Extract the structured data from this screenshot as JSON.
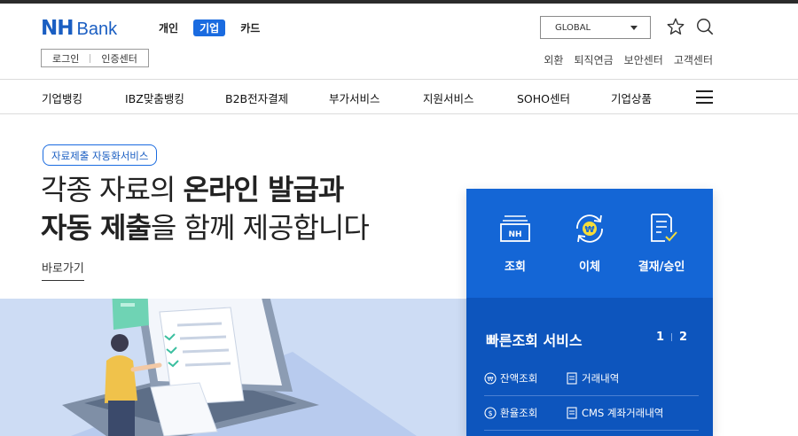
{
  "header": {
    "logo_nh": "NH",
    "logo_bank": "Bank",
    "segments": [
      "개인",
      "기업",
      "카드"
    ],
    "active_segment": "기업",
    "login": "로그인",
    "cert_center": "인증센터",
    "global_select": "GLOBAL",
    "util_links": [
      "외환",
      "퇴직연금",
      "보안센터",
      "고객센터"
    ]
  },
  "gnb": {
    "items": [
      "기업뱅킹",
      "IBZ맞춤뱅킹",
      "B2B전자결제",
      "부가서비스",
      "지원서비스",
      "SOHO센터",
      "기업상품"
    ]
  },
  "hero": {
    "badge": "자료제출 자동화서비스",
    "line1_normal": "각종 자료의 ",
    "line1_bold": "온라인 발급과",
    "line2_bold": "자동 제출",
    "line2_normal": "을 함께 제공합니다",
    "shortcut": "바로가기"
  },
  "panel": {
    "services": [
      {
        "label": "조회",
        "icon": "inquiry-icon"
      },
      {
        "label": "이체",
        "icon": "transfer-icon"
      },
      {
        "label": "결재/승인",
        "icon": "approval-icon"
      }
    ],
    "quick_title": "빠른조회 서비스",
    "page_current": "1",
    "page_total": "2",
    "quick_items": [
      "잔액조회",
      "거래내역",
      "환율조회",
      "CMS 계좌거래내역"
    ]
  },
  "colors": {
    "brand_blue": "#1a5ec2",
    "panel_top": "#1466d6",
    "panel_bottom": "#0d55bd",
    "illustration_bg": "#cddcf4"
  }
}
